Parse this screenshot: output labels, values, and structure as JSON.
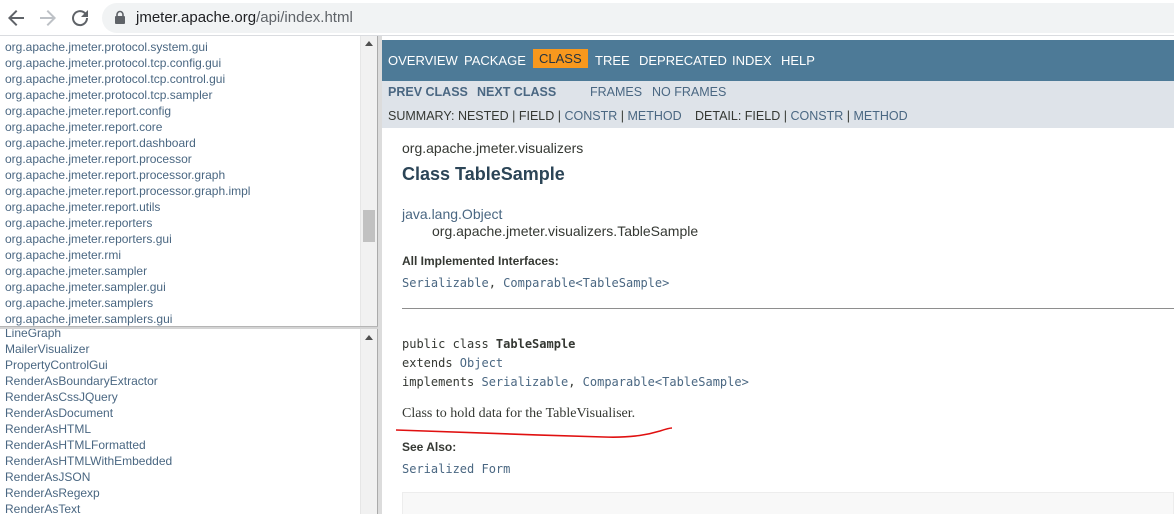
{
  "browser": {
    "url_host": "jmeter.apache.org",
    "url_path": "/api/index.html"
  },
  "package_list": [
    "org.apache.jmeter.protocol.system.gui",
    "org.apache.jmeter.protocol.tcp.config.gui",
    "org.apache.jmeter.protocol.tcp.control.gui",
    "org.apache.jmeter.protocol.tcp.sampler",
    "org.apache.jmeter.report.config",
    "org.apache.jmeter.report.core",
    "org.apache.jmeter.report.dashboard",
    "org.apache.jmeter.report.processor",
    "org.apache.jmeter.report.processor.graph",
    "org.apache.jmeter.report.processor.graph.impl",
    "org.apache.jmeter.report.utils",
    "org.apache.jmeter.reporters",
    "org.apache.jmeter.reporters.gui",
    "org.apache.jmeter.rmi",
    "org.apache.jmeter.sampler",
    "org.apache.jmeter.sampler.gui",
    "org.apache.jmeter.samplers",
    "org.apache.jmeter.samplers.gui"
  ],
  "class_list": [
    "LineGraph",
    "MailerVisualizer",
    "PropertyControlGui",
    "RenderAsBoundaryExtractor",
    "RenderAsCssJQuery",
    "RenderAsDocument",
    "RenderAsHTML",
    "RenderAsHTMLFormatted",
    "RenderAsHTMLWithEmbedded",
    "RenderAsJSON",
    "RenderAsRegexp",
    "RenderAsText"
  ],
  "nav": {
    "overview": "OVERVIEW",
    "package": "PACKAGE",
    "class": "CLASS",
    "tree": "TREE",
    "deprecated": "DEPRECATED",
    "index": "INDEX",
    "help": "HELP"
  },
  "subnav": {
    "prev_class": "PREV CLASS",
    "next_class": "NEXT CLASS",
    "frames": "FRAMES",
    "no_frames": "NO FRAMES",
    "summary_label": "SUMMARY:",
    "summary_nested": "NESTED",
    "summary_field": "FIELD",
    "summary_constr": "CONSTR",
    "summary_method": "METHOD",
    "detail_label": "DETAIL:",
    "detail_field": "FIELD",
    "detail_constr": "CONSTR",
    "detail_method": "METHOD",
    "sep": "|"
  },
  "content": {
    "package_name": "org.apache.jmeter.visualizers",
    "class_title": "Class TableSample",
    "inherit_parent": "java.lang.Object",
    "inherit_child": "org.apache.jmeter.visualizers.TableSample",
    "interfaces_label": "All Implemented Interfaces:",
    "iface_serializable": "Serializable",
    "iface_comparable": "Comparable<TableSample>",
    "comma": ",",
    "decl_prefix": "public class ",
    "decl_name": "TableSample",
    "extends_kw": "extends ",
    "extends_type": "Object",
    "implements_kw": "implements ",
    "description": "Class to hold data for the TableVisualiser.",
    "see_also_label": "See Also:",
    "serialized_form": "Serialized Form"
  },
  "colors": {
    "nav_bg": "#4d7a97",
    "nav_selected_bg": "#f8981d",
    "subnav_bg": "#dee3e9",
    "link": "#4a6782",
    "text": "#353833",
    "annotation": "#e01010"
  }
}
